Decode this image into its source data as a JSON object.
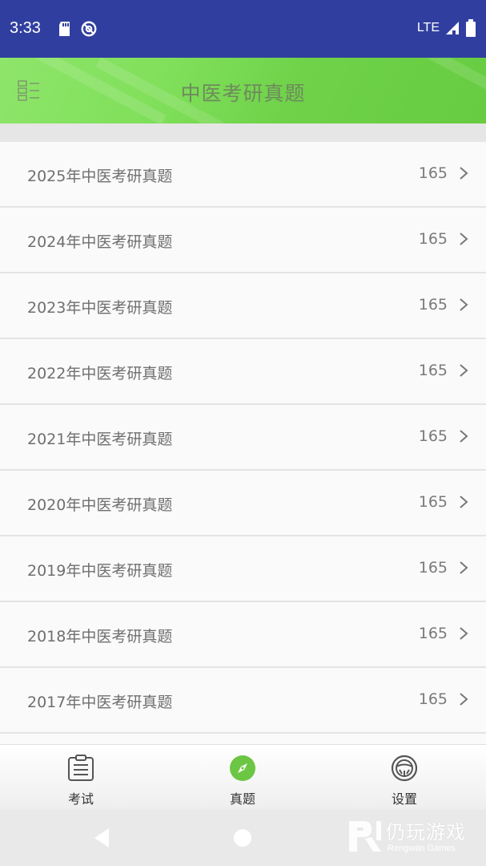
{
  "status_bar": {
    "time": "3:33",
    "network": "LTE"
  },
  "header": {
    "title": "中医考研真题"
  },
  "papers": [
    {
      "title": "2025年中医考研真题",
      "count": "165"
    },
    {
      "title": "2024年中医考研真题",
      "count": "165"
    },
    {
      "title": "2023年中医考研真题",
      "count": "165"
    },
    {
      "title": "2022年中医考研真题",
      "count": "165"
    },
    {
      "title": "2021年中医考研真题",
      "count": "165"
    },
    {
      "title": "2020年中医考研真题",
      "count": "165"
    },
    {
      "title": "2019年中医考研真题",
      "count": "165"
    },
    {
      "title": "2018年中医考研真题",
      "count": "165"
    },
    {
      "title": "2017年中医考研真题",
      "count": "165"
    }
  ],
  "tabs": [
    {
      "label": "考试",
      "icon": "clipboard-icon"
    },
    {
      "label": "真题",
      "icon": "compass-icon",
      "active": true
    },
    {
      "label": "设置",
      "icon": "steering-wheel-icon"
    }
  ],
  "watermark": {
    "text": "仍玩游戏",
    "sub": "Rengwan Games"
  },
  "colors": {
    "status_bar": "#303f9f",
    "header_green": "#7ddb58",
    "active_tab": "#6cc644"
  }
}
